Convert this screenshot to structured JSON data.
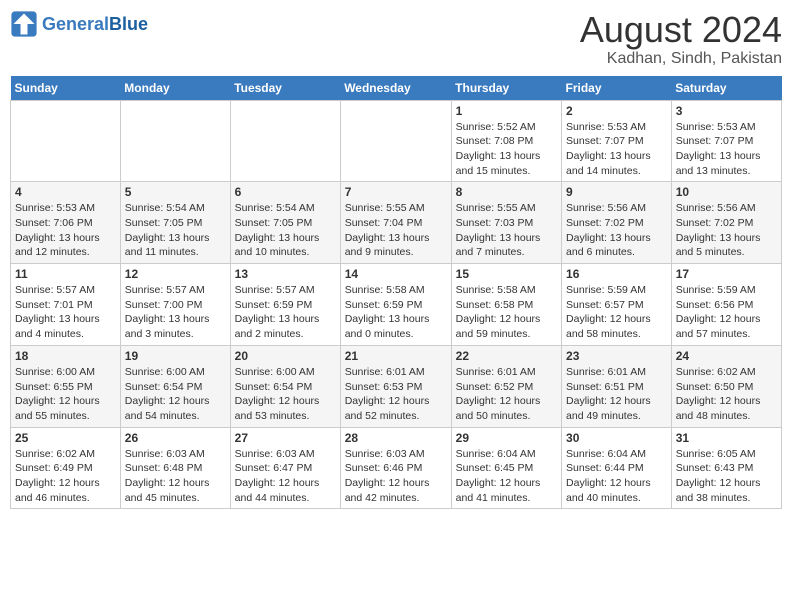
{
  "header": {
    "logo_general": "General",
    "logo_blue": "Blue",
    "month_year": "August 2024",
    "location": "Kadhan, Sindh, Pakistan"
  },
  "days_of_week": [
    "Sunday",
    "Monday",
    "Tuesday",
    "Wednesday",
    "Thursday",
    "Friday",
    "Saturday"
  ],
  "weeks": [
    {
      "cells": [
        {
          "date": "",
          "info": ""
        },
        {
          "date": "",
          "info": ""
        },
        {
          "date": "",
          "info": ""
        },
        {
          "date": "",
          "info": ""
        },
        {
          "date": "1",
          "info": "Sunrise: 5:52 AM\nSunset: 7:08 PM\nDaylight: 13 hours\nand 15 minutes."
        },
        {
          "date": "2",
          "info": "Sunrise: 5:53 AM\nSunset: 7:07 PM\nDaylight: 13 hours\nand 14 minutes."
        },
        {
          "date": "3",
          "info": "Sunrise: 5:53 AM\nSunset: 7:07 PM\nDaylight: 13 hours\nand 13 minutes."
        }
      ]
    },
    {
      "cells": [
        {
          "date": "4",
          "info": "Sunrise: 5:53 AM\nSunset: 7:06 PM\nDaylight: 13 hours\nand 12 minutes."
        },
        {
          "date": "5",
          "info": "Sunrise: 5:54 AM\nSunset: 7:05 PM\nDaylight: 13 hours\nand 11 minutes."
        },
        {
          "date": "6",
          "info": "Sunrise: 5:54 AM\nSunset: 7:05 PM\nDaylight: 13 hours\nand 10 minutes."
        },
        {
          "date": "7",
          "info": "Sunrise: 5:55 AM\nSunset: 7:04 PM\nDaylight: 13 hours\nand 9 minutes."
        },
        {
          "date": "8",
          "info": "Sunrise: 5:55 AM\nSunset: 7:03 PM\nDaylight: 13 hours\nand 7 minutes."
        },
        {
          "date": "9",
          "info": "Sunrise: 5:56 AM\nSunset: 7:02 PM\nDaylight: 13 hours\nand 6 minutes."
        },
        {
          "date": "10",
          "info": "Sunrise: 5:56 AM\nSunset: 7:02 PM\nDaylight: 13 hours\nand 5 minutes."
        }
      ]
    },
    {
      "cells": [
        {
          "date": "11",
          "info": "Sunrise: 5:57 AM\nSunset: 7:01 PM\nDaylight: 13 hours\nand 4 minutes."
        },
        {
          "date": "12",
          "info": "Sunrise: 5:57 AM\nSunset: 7:00 PM\nDaylight: 13 hours\nand 3 minutes."
        },
        {
          "date": "13",
          "info": "Sunrise: 5:57 AM\nSunset: 6:59 PM\nDaylight: 13 hours\nand 2 minutes."
        },
        {
          "date": "14",
          "info": "Sunrise: 5:58 AM\nSunset: 6:59 PM\nDaylight: 13 hours\nand 0 minutes."
        },
        {
          "date": "15",
          "info": "Sunrise: 5:58 AM\nSunset: 6:58 PM\nDaylight: 12 hours\nand 59 minutes."
        },
        {
          "date": "16",
          "info": "Sunrise: 5:59 AM\nSunset: 6:57 PM\nDaylight: 12 hours\nand 58 minutes."
        },
        {
          "date": "17",
          "info": "Sunrise: 5:59 AM\nSunset: 6:56 PM\nDaylight: 12 hours\nand 57 minutes."
        }
      ]
    },
    {
      "cells": [
        {
          "date": "18",
          "info": "Sunrise: 6:00 AM\nSunset: 6:55 PM\nDaylight: 12 hours\nand 55 minutes."
        },
        {
          "date": "19",
          "info": "Sunrise: 6:00 AM\nSunset: 6:54 PM\nDaylight: 12 hours\nand 54 minutes."
        },
        {
          "date": "20",
          "info": "Sunrise: 6:00 AM\nSunset: 6:54 PM\nDaylight: 12 hours\nand 53 minutes."
        },
        {
          "date": "21",
          "info": "Sunrise: 6:01 AM\nSunset: 6:53 PM\nDaylight: 12 hours\nand 52 minutes."
        },
        {
          "date": "22",
          "info": "Sunrise: 6:01 AM\nSunset: 6:52 PM\nDaylight: 12 hours\nand 50 minutes."
        },
        {
          "date": "23",
          "info": "Sunrise: 6:01 AM\nSunset: 6:51 PM\nDaylight: 12 hours\nand 49 minutes."
        },
        {
          "date": "24",
          "info": "Sunrise: 6:02 AM\nSunset: 6:50 PM\nDaylight: 12 hours\nand 48 minutes."
        }
      ]
    },
    {
      "cells": [
        {
          "date": "25",
          "info": "Sunrise: 6:02 AM\nSunset: 6:49 PM\nDaylight: 12 hours\nand 46 minutes."
        },
        {
          "date": "26",
          "info": "Sunrise: 6:03 AM\nSunset: 6:48 PM\nDaylight: 12 hours\nand 45 minutes."
        },
        {
          "date": "27",
          "info": "Sunrise: 6:03 AM\nSunset: 6:47 PM\nDaylight: 12 hours\nand 44 minutes."
        },
        {
          "date": "28",
          "info": "Sunrise: 6:03 AM\nSunset: 6:46 PM\nDaylight: 12 hours\nand 42 minutes."
        },
        {
          "date": "29",
          "info": "Sunrise: 6:04 AM\nSunset: 6:45 PM\nDaylight: 12 hours\nand 41 minutes."
        },
        {
          "date": "30",
          "info": "Sunrise: 6:04 AM\nSunset: 6:44 PM\nDaylight: 12 hours\nand 40 minutes."
        },
        {
          "date": "31",
          "info": "Sunrise: 6:05 AM\nSunset: 6:43 PM\nDaylight: 12 hours\nand 38 minutes."
        }
      ]
    }
  ]
}
